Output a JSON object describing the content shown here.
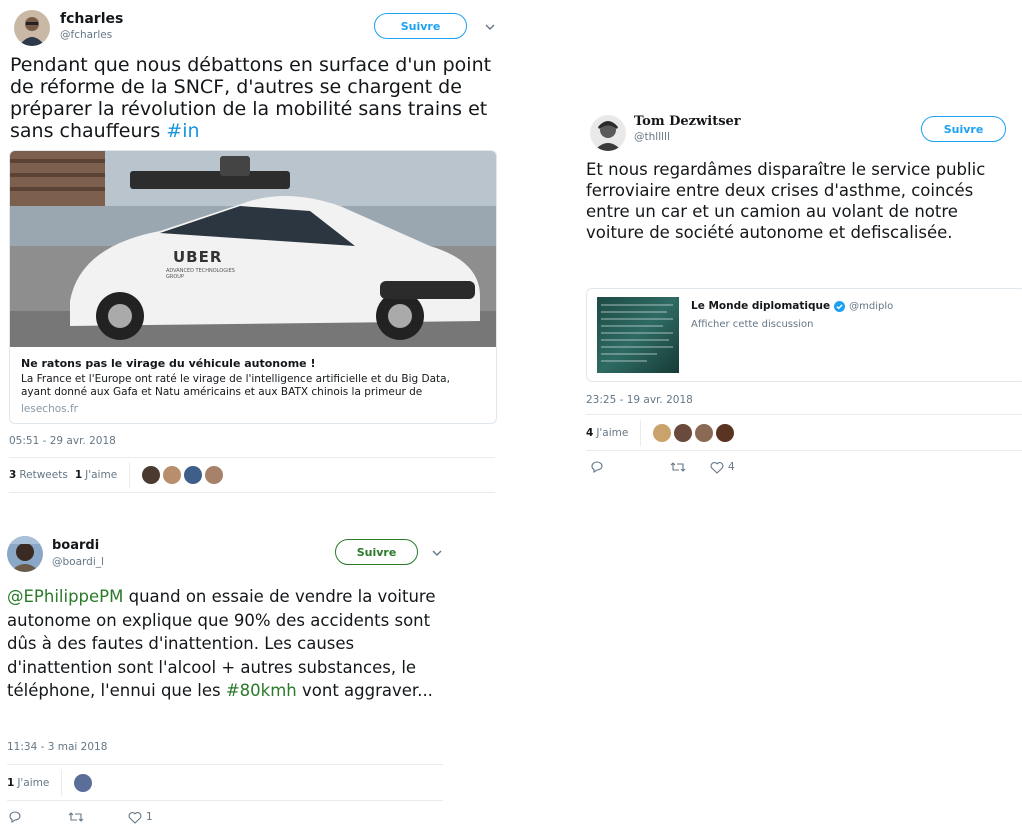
{
  "tweet1": {
    "name": "fcharles",
    "handle": "@fcharles",
    "follow_label": "Suivre",
    "text_main": "Pendant que nous débattons en surface d'un point de  réforme de la SNCF, d'autres se chargent de préparer la révolution de la mobilité sans trains et sans chauffeurs ",
    "hashtag": "#in",
    "card": {
      "car_brand": "UBER",
      "car_decal": "ADVANCED TECHNOLOGIES GROUP",
      "title": "Ne ratons pas le virage du véhicule autonome !",
      "description": "La France et l'Europe ont raté le virage de l'intelligence artificielle et du Big Data, ayant donné aux Gafa et Natu américains et aux BATX chinois la primeur de",
      "domain": "lesechos.fr"
    },
    "timestamp": "05:51 - 29 avr. 2018",
    "retweets_count": "3",
    "retweets_label": "Retweets",
    "likes_count": "1",
    "likes_label": "J'aime"
  },
  "tweet2": {
    "name": "Tom Dezwitser",
    "handle": "@thlllll",
    "follow_label": "Suivre",
    "text": "Et nous regardâmes disparaître le service public ferroviaire entre deux crises d'asthme, coincés entre un car et un camion au volant de notre voiture de société autonome et defiscalisée.",
    "quoted": {
      "name": "Le Monde diplomatique",
      "handle": "@mdiplo",
      "link": "Afficher cette discussion"
    },
    "timestamp": "23:25 - 19 avr. 2018",
    "likes_count": "4",
    "likes_label": "J'aime",
    "like_action_count": "4"
  },
  "tweet3": {
    "name": "boardi",
    "handle": "@boardi_l",
    "follow_label": "Suivre",
    "mention": "@EPhilippePM",
    "text_main": " quand on essaie de vendre la voiture autonome on explique que 90% des accidents sont dûs à des fautes d'inattention. Les causes d'inattention sont l'alcool + autres substances, le téléphone, l'ennui que les ",
    "hashtag": "#80kmh",
    "text_end": " vont aggraver...",
    "timestamp": "11:34 - 3 mai 2018",
    "likes_count": "1",
    "likes_label": "J'aime",
    "like_action_count": "1"
  },
  "colors": {
    "link_blue": "#1b95e0",
    "link_green": "#2a7a2a",
    "follow_blue": "#1da1f2",
    "verified": "#1da1f2",
    "muted": "#657786"
  },
  "icons": [
    "chevron-down-icon",
    "reply-icon",
    "retweet-icon",
    "like-icon",
    "verified-badge-icon"
  ]
}
